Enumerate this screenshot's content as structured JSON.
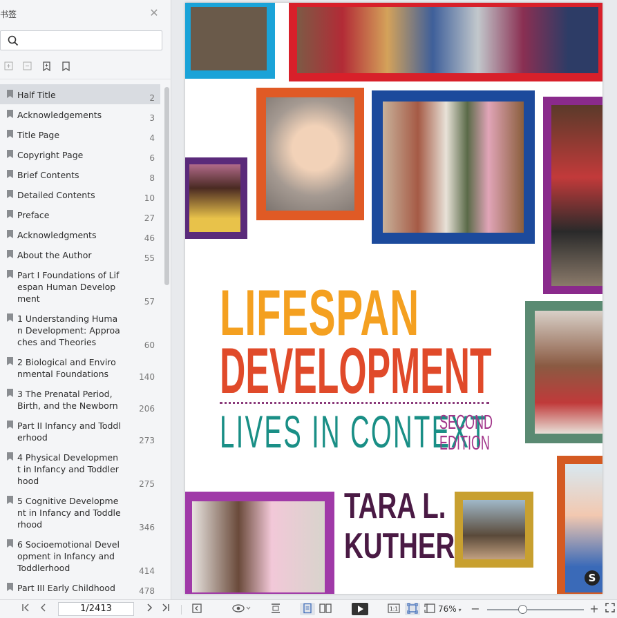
{
  "sidebar": {
    "title": "书签",
    "search": {
      "placeholder": ""
    },
    "bookmarks": [
      {
        "label": "Half Title",
        "page": "2"
      },
      {
        "label": "Acknowledgements",
        "page": "3"
      },
      {
        "label": "Title Page",
        "page": "4"
      },
      {
        "label": "Copyright Page",
        "page": "6"
      },
      {
        "label": "Brief Contents",
        "page": "8"
      },
      {
        "label": "Detailed Contents",
        "page": "10"
      },
      {
        "label": "Preface",
        "page": "27"
      },
      {
        "label": "Acknowledgments",
        "page": "46"
      },
      {
        "label": "About the Author",
        "page": "55"
      },
      {
        "label": "Part I Foundations of Lifespan Human Development",
        "page": "57"
      },
      {
        "label": "1 Understanding Human Development: Approaches and Theories",
        "page": "60"
      },
      {
        "label": "2 Biological and Environmental Foundations",
        "page": "140"
      },
      {
        "label": "3 The Prenatal Period, Birth, and the Newborn",
        "page": "206"
      },
      {
        "label": "Part II Infancy and Toddlerhood",
        "page": "273"
      },
      {
        "label": "4 Physical Development in Infancy and Toddlerhood",
        "page": "275"
      },
      {
        "label": "5 Cognitive Development in Infancy and Toddlerhood",
        "page": "346"
      },
      {
        "label": "6 Socioemotional Development in Infancy and Toddlerhood",
        "page": "414"
      },
      {
        "label": "Part III Early Childhood",
        "page": "478"
      }
    ]
  },
  "document": {
    "cover_title_line1": "LIFESPAN",
    "cover_title_line2": "DEVELOPMENT",
    "cover_subtitle": "LIVES IN CONTEXT",
    "cover_edition_line1": "SECOND",
    "cover_edition_line2": "EDITION",
    "author_line1": "TARA L.",
    "author_line2": "KUTHER",
    "publisher_mark": "S"
  },
  "toolbar": {
    "page_indicator": "1/2413",
    "zoom": "76%"
  },
  "colors": {
    "title_orange": "#f4a020",
    "title_red": "#e04a2a",
    "subtitle_teal": "#1a8f86",
    "edition_purple": "#a2368a",
    "author_plum": "#4a1a44"
  }
}
